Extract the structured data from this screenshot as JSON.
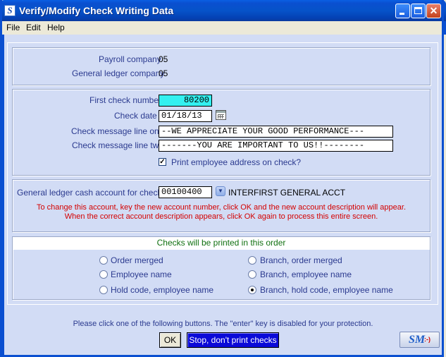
{
  "window": {
    "title": "Verify/Modify Check Writing Data",
    "icon_letter": "S"
  },
  "menu": [
    "File",
    "Edit",
    "Help"
  ],
  "company": {
    "payroll_label": "Payroll company",
    "payroll_value": "05",
    "gl_label": "General ledger company",
    "gl_value": "05"
  },
  "check": {
    "first_label": "First check number",
    "first_value": "80200",
    "date_label": "Check date",
    "date_value": "01/18/13",
    "msg1_label": "Check message line one",
    "msg1_value": "--WE APPRECIATE YOUR GOOD PERFORMANCE---",
    "msg2_label": "Check message line two",
    "msg2_value": "-------YOU ARE IMPORTANT TO US!!--------",
    "print_address_label": "Print employee address on check?",
    "print_address_checked": true
  },
  "cash_account": {
    "label": "General ledger cash account for checks",
    "value": "00100400",
    "description": "INTERFIRST GENERAL ACCT",
    "note1": "To change this account, key the new account number, click OK and the new account description will appear.",
    "note2": "When the correct account description appears, click OK again to process this entire screen."
  },
  "order": {
    "header": "Checks will be printed in this order",
    "options": [
      {
        "label": "Order merged",
        "selected": false
      },
      {
        "label": "Branch, order merged",
        "selected": false
      },
      {
        "label": "Employee name",
        "selected": false
      },
      {
        "label": "Branch, employee name",
        "selected": false
      },
      {
        "label": "Hold code, employee name",
        "selected": false
      },
      {
        "label": "Branch, hold code, employee name",
        "selected": true
      }
    ]
  },
  "footer": {
    "instructions": "Please click one of the following buttons.  The \"enter\" key is disabled for your protection.",
    "ok_label": "OK",
    "stop_label": "Stop, don't print checks",
    "logo_text": "SM",
    "logo_face": ":-)"
  },
  "colors": {
    "titlebar": "#0a4fd0",
    "client": "#d2dcf5",
    "highlight_field": "#33f0f0",
    "note_red": "#d40000",
    "label_blue": "#2b3a8f",
    "header_green": "#107010",
    "stop_button": "#0a0ad8"
  }
}
